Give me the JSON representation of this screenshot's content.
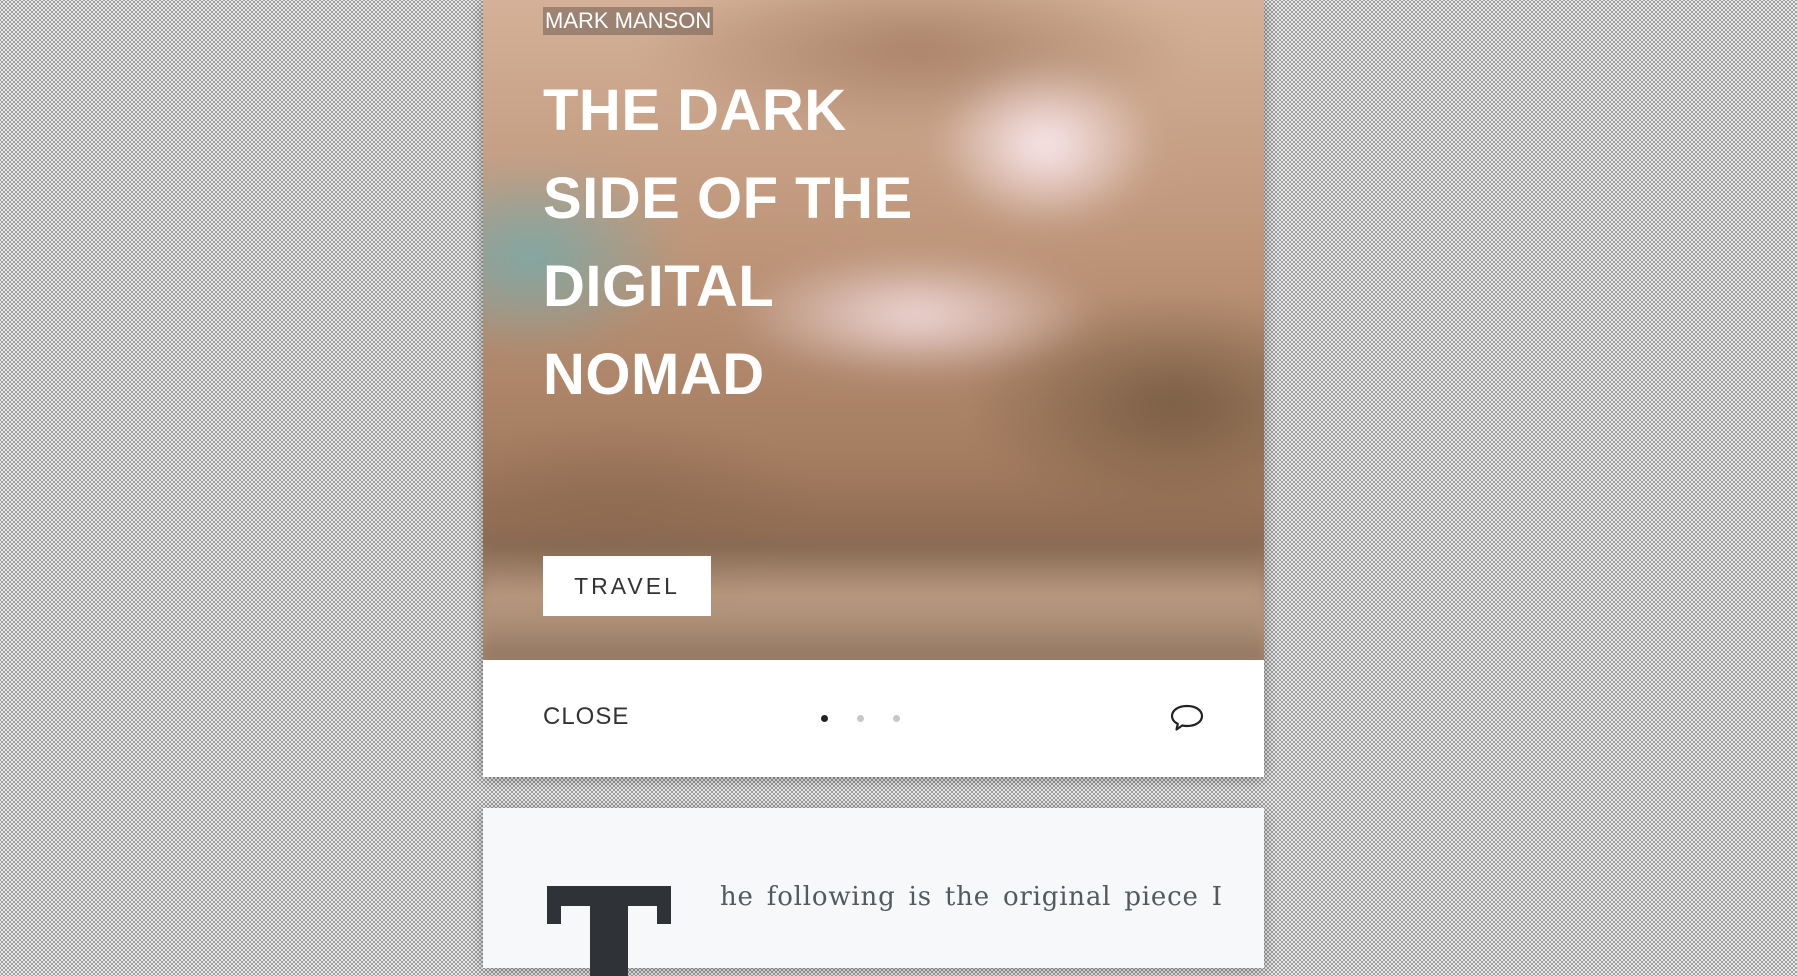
{
  "hero": {
    "author": "MARK MANSON",
    "title": "THE DARK SIDE OF THE DIGITAL NOMAD",
    "category": "TRAVEL"
  },
  "footer": {
    "close_label": "CLOSE",
    "pagination": {
      "total": 3,
      "active_index": 0
    },
    "comment_icon": "comment-icon"
  },
  "article": {
    "drop_cap": "T",
    "lead_text": "he following is the original piece I"
  },
  "colors": {
    "card": "#ffffff",
    "article_bg": "#f7f8f9",
    "text_dark": "#333333",
    "dot_active": "#222222",
    "dot_inactive": "#c8c8c8",
    "drop_cap": "#2f3337"
  }
}
